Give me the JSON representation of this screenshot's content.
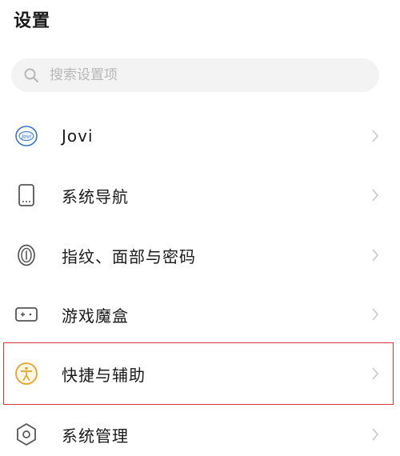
{
  "header": {
    "title": "设置"
  },
  "search": {
    "placeholder": "搜索设置项"
  },
  "menu": {
    "items": [
      {
        "label": "Jovi",
        "icon": "jovi-icon"
      },
      {
        "label": "系统导航",
        "icon": "phone-navigation-icon"
      },
      {
        "label": "指纹、面部与密码",
        "icon": "fingerprint-icon"
      },
      {
        "label": "游戏魔盒",
        "icon": "gamepad-icon"
      },
      {
        "label": "快捷与辅助",
        "icon": "accessibility-icon"
      },
      {
        "label": "系统管理",
        "icon": "system-management-icon"
      }
    ]
  },
  "colors": {
    "accent": "#3a77c5",
    "highlight": "#d23a3a",
    "accessibility_icon": "#e2a728"
  }
}
